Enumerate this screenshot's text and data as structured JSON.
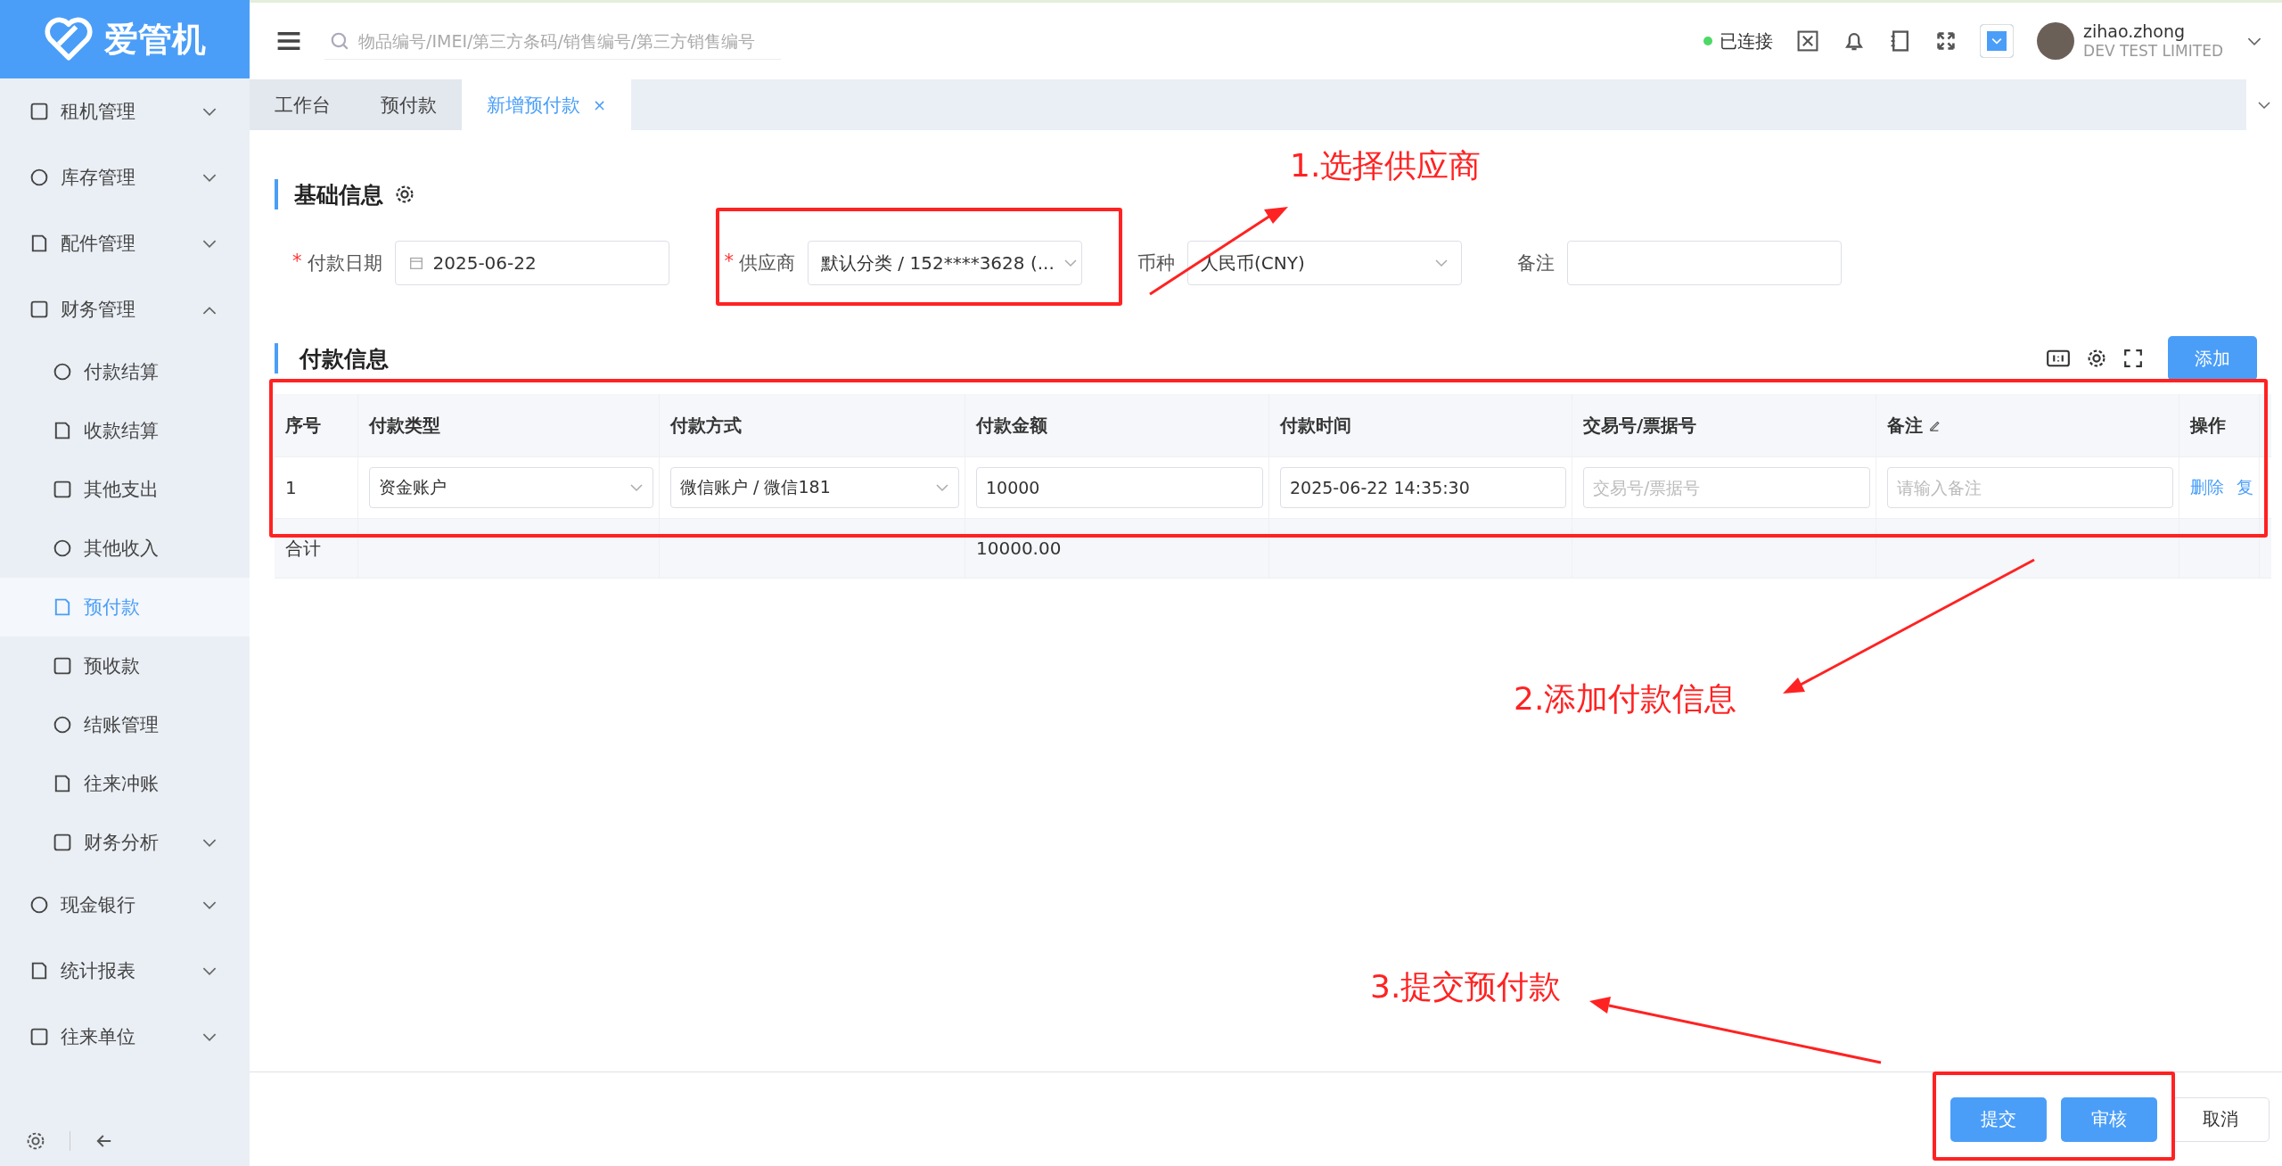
{
  "logo": {
    "text": "爱管机"
  },
  "sidebar": {
    "items": [
      {
        "label": "租机管理",
        "kind": "group",
        "expanded": false,
        "selected": false
      },
      {
        "label": "库存管理",
        "kind": "group",
        "expanded": false,
        "selected": false
      },
      {
        "label": "配件管理",
        "kind": "group",
        "expanded": false,
        "selected": false
      },
      {
        "label": "财务管理",
        "kind": "group",
        "expanded": true,
        "selected": false,
        "children": [
          {
            "label": "付款结算",
            "kind": "item",
            "selected": false
          },
          {
            "label": "收款结算",
            "kind": "item",
            "selected": false
          },
          {
            "label": "其他支出",
            "kind": "item",
            "selected": false
          },
          {
            "label": "其他收入",
            "kind": "item",
            "selected": false
          },
          {
            "label": "预付款",
            "kind": "item",
            "selected": true
          },
          {
            "label": "预收款",
            "kind": "item",
            "selected": false
          },
          {
            "label": "结账管理",
            "kind": "item",
            "selected": false
          },
          {
            "label": "往来冲账",
            "kind": "item",
            "selected": false
          },
          {
            "label": "财务分析",
            "kind": "group",
            "expanded": false,
            "selected": false
          }
        ]
      },
      {
        "label": "现金银行",
        "kind": "group",
        "expanded": false,
        "selected": false
      },
      {
        "label": "统计报表",
        "kind": "group",
        "expanded": false,
        "selected": false
      },
      {
        "label": "往来单位",
        "kind": "group",
        "expanded": false,
        "selected": false
      }
    ]
  },
  "header": {
    "search": {
      "placeholder": "物品编号/IMEI/第三方条码/销售编号/第三方销售编号"
    },
    "status": {
      "label": "已连接",
      "connected": true
    },
    "user": {
      "name": "zihao.zhong",
      "company": "DEV TEST LIMITED"
    }
  },
  "tabs": [
    {
      "label": "工作台",
      "selected": false
    },
    {
      "label": "预付款",
      "selected": false
    },
    {
      "label": "新增预付款",
      "selected": true,
      "close": "×"
    }
  ],
  "basic_info": {
    "title": "基础信息",
    "fields": [
      {
        "label": "付款日期",
        "required_mark": "*",
        "kind": "date",
        "value": "2025-06-22"
      },
      {
        "label": "供应商",
        "required_mark": "*",
        "kind": "supplier",
        "value": "默认分类 / 152****3628 (..."
      },
      {
        "label": "币种",
        "kind": "select",
        "value": "人民币(CNY)"
      },
      {
        "label": "备注",
        "kind": "text"
      }
    ]
  },
  "payment_info": {
    "title": "付款信息",
    "add_button": "添加",
    "table": {
      "columns": [
        "序号",
        "付款类型",
        "付款方式",
        "付款金额",
        "付款时间",
        "交易号/票据号",
        "备注",
        "操作"
      ],
      "rows": [
        {
          "index": "1",
          "type": "资金账户",
          "method": "微信账户 / 微信181",
          "amount": "10000",
          "time": "2025-06-22 14:35:30",
          "trade_no_placeholder": "交易号/票据号",
          "remark_placeholder": "请输入备注",
          "actions": [
            "删除",
            "复"
          ]
        }
      ],
      "total": {
        "label": "合计",
        "amount": "10000.00"
      }
    }
  },
  "footer": {
    "buttons": [
      {
        "label": "提交",
        "kind": "primary"
      },
      {
        "label": "审核",
        "kind": "primary"
      },
      {
        "label": "取消",
        "kind": "default"
      }
    ]
  },
  "annotations": [
    {
      "text": "1.选择供应商"
    },
    {
      "text": "2.添加付款信息"
    },
    {
      "text": "3.提交预付款"
    }
  ]
}
